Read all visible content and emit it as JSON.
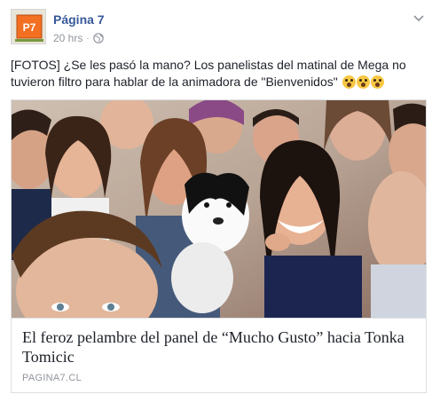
{
  "post": {
    "page_name": "Página 7",
    "page_logo_text": "P7",
    "time": "20 hrs",
    "separator": "·",
    "privacy_icon": "globe-icon",
    "options_icon": "chevron-down-icon",
    "text": "[FOTOS] ¿Se les pasó la mano? Los panelistas del matinal de Mega no tuvieron filtro para hablar de la animadora de \"Bienvenidos\"",
    "emojis": [
      "face-screaming-emoji",
      "frowning-face-emoji",
      "face-screaming-emoji"
    ]
  },
  "link_card": {
    "image": "group-selfie-photo",
    "title": "El feroz pelambre del panel de “Mucho Gusto” hacia Tonka Tomicic",
    "domain": "PAGINA7.CL"
  },
  "colors": {
    "link": "#365899",
    "meta": "#90949c",
    "border": "#dddfe2",
    "logo_orange": "#f36f21"
  }
}
